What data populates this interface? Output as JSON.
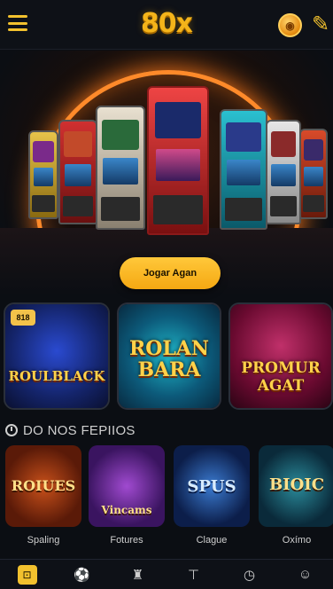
{
  "header": {
    "logo": "80x",
    "menu_icon": "hamburger-icon",
    "coin_icon": "coin-icon",
    "edit_icon": "pencil-icon"
  },
  "hero": {
    "cta_label": "Jogar Agan",
    "accent_color": "#ff8a2a"
  },
  "featured": [
    {
      "title": "ROULBLACK",
      "badge": "818"
    },
    {
      "title": "ROLAN BARA",
      "badge": ""
    },
    {
      "title": "PROMUR AGAT",
      "badge": ""
    }
  ],
  "section": {
    "title": "DO NOS FEPIIOS",
    "icon": "clock-icon"
  },
  "games": [
    {
      "label": "Spaling",
      "art_text": "ROIUES"
    },
    {
      "label": "Fotures",
      "art_text": "Vincams"
    },
    {
      "label": "Clague",
      "art_text": "SPUS"
    },
    {
      "label": "Oxímo",
      "art_text": "BIOIC"
    }
  ],
  "bottom_nav": [
    {
      "icon": "home-icon",
      "glyph": "⊡",
      "active": true
    },
    {
      "icon": "sports-icon",
      "glyph": "⚽",
      "active": false
    },
    {
      "icon": "casino-icon",
      "glyph": "♜",
      "active": false
    },
    {
      "icon": "table-icon",
      "glyph": "⊤",
      "active": false
    },
    {
      "icon": "timer-icon",
      "glyph": "◷",
      "active": false
    },
    {
      "icon": "profile-icon",
      "glyph": "☺",
      "active": false
    }
  ]
}
